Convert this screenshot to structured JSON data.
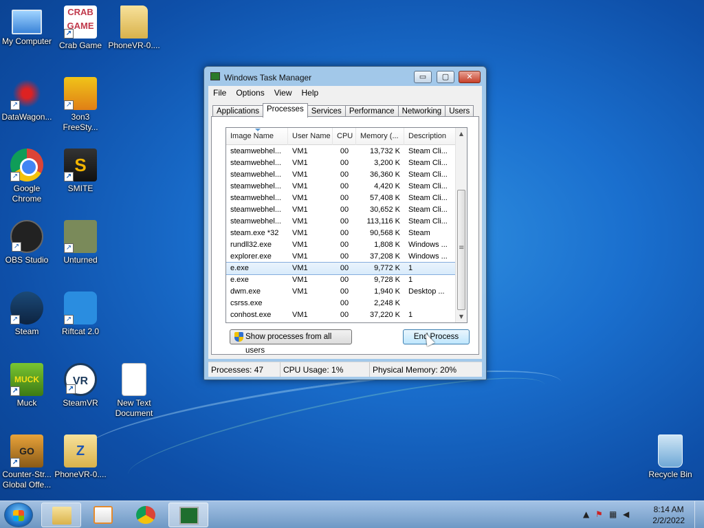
{
  "desktop": {
    "icons": [
      {
        "label": "My Computer"
      },
      {
        "label": "Crab Game",
        "art": "CRAB GAME"
      },
      {
        "label": "PhoneVR-0...."
      },
      {
        "label": "DataWagon..."
      },
      {
        "label": "3on3 FreeSty..."
      },
      {
        "label": "Google Chrome"
      },
      {
        "label": "SMITE",
        "art": "S"
      },
      {
        "label": "OBS Studio"
      },
      {
        "label": "Unturned"
      },
      {
        "label": "Steam"
      },
      {
        "label": "Riftcat 2.0"
      },
      {
        "label": "Muck",
        "art": "MUCK"
      },
      {
        "label": "SteamVR",
        "art": "VR"
      },
      {
        "label": "New Text Document"
      },
      {
        "label": "Counter-Str... Global Offe...",
        "art": "GO"
      },
      {
        "label": "PhoneVR-0....",
        "art": "Z"
      },
      {
        "label": "Recycle Bin"
      }
    ]
  },
  "window": {
    "title": "Windows Task Manager",
    "controls": {
      "minimize": "▭",
      "maximize": "▢",
      "close": "✕"
    },
    "menu": [
      "File",
      "Options",
      "View",
      "Help"
    ],
    "tabs": [
      "Applications",
      "Processes",
      "Services",
      "Performance",
      "Networking",
      "Users"
    ],
    "active_tab": "Processes",
    "columns": [
      "Image Name",
      "User Name",
      "CPU",
      "Memory (...",
      "Description"
    ],
    "processes": [
      {
        "name": "steamwebhel...",
        "user": "VM1",
        "cpu": "00",
        "memory": "13,732 K",
        "description": "Steam Cli..."
      },
      {
        "name": "steamwebhel...",
        "user": "VM1",
        "cpu": "00",
        "memory": "3,200 K",
        "description": "Steam Cli..."
      },
      {
        "name": "steamwebhel...",
        "user": "VM1",
        "cpu": "00",
        "memory": "36,360 K",
        "description": "Steam Cli..."
      },
      {
        "name": "steamwebhel...",
        "user": "VM1",
        "cpu": "00",
        "memory": "4,420 K",
        "description": "Steam Cli..."
      },
      {
        "name": "steamwebhel...",
        "user": "VM1",
        "cpu": "00",
        "memory": "57,408 K",
        "description": "Steam Cli..."
      },
      {
        "name": "steamwebhel...",
        "user": "VM1",
        "cpu": "00",
        "memory": "30,652 K",
        "description": "Steam Cli..."
      },
      {
        "name": "steamwebhel...",
        "user": "VM1",
        "cpu": "00",
        "memory": "113,116 K",
        "description": "Steam Cli..."
      },
      {
        "name": "steam.exe *32",
        "user": "VM1",
        "cpu": "00",
        "memory": "90,568 K",
        "description": "Steam"
      },
      {
        "name": "rundll32.exe",
        "user": "VM1",
        "cpu": "00",
        "memory": "1,808 K",
        "description": "Windows ..."
      },
      {
        "name": "explorer.exe",
        "user": "VM1",
        "cpu": "00",
        "memory": "37,208 K",
        "description": "Windows ..."
      },
      {
        "name": "e.exe",
        "user": "VM1",
        "cpu": "00",
        "memory": "9,772 K",
        "description": "1",
        "selected": true
      },
      {
        "name": "e.exe",
        "user": "VM1",
        "cpu": "00",
        "memory": "9,728 K",
        "description": "1"
      },
      {
        "name": "dwm.exe",
        "user": "VM1",
        "cpu": "00",
        "memory": "1,940 K",
        "description": "Desktop ..."
      },
      {
        "name": "csrss.exe",
        "user": "",
        "cpu": "00",
        "memory": "2,248 K",
        "description": ""
      },
      {
        "name": "conhost.exe",
        "user": "VM1",
        "cpu": "00",
        "memory": "37,220 K",
        "description": "1"
      }
    ],
    "show_all_label": "Show processes from all users",
    "end_process_label": "End Process",
    "status": {
      "processes": "Processes: 47",
      "cpu": "CPU Usage: 1%",
      "memory": "Physical Memory: 20%"
    }
  },
  "taskbar": {
    "clock_time": "8:14 AM",
    "clock_date": "2/2/2022",
    "tray_arrow": "▲"
  }
}
